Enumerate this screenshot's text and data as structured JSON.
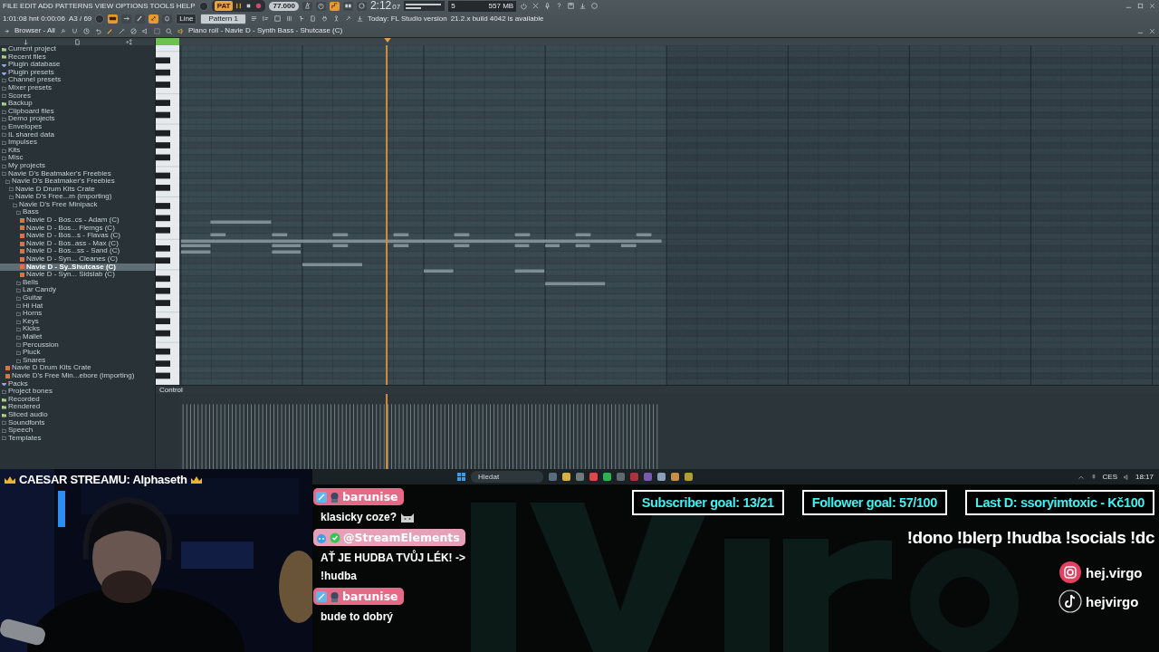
{
  "daw": {
    "menu": "FILE EDIT ADD PATTERNS VIEW OPTIONS TOOLS HELP",
    "pat_label": "PAT",
    "tempo": "77.000",
    "time": "2:12",
    "time_sub": "07",
    "cpu": "5",
    "memory": "557 MB",
    "hint": "1:01:08 hnt 0:00:06",
    "hint_right": "A3 / 69",
    "snap": "Line",
    "pattern": "Pattern 1",
    "news": [
      "Today: FL Studio version",
      "21.2.x build 4042 is available"
    ],
    "toggles_top": [
      {
        "kind": "metronome",
        "on": false
      },
      {
        "kind": "wait",
        "on": false
      },
      {
        "kind": "step",
        "on": true
      },
      {
        "kind": "blend",
        "on": false
      },
      {
        "kind": "loop",
        "on": false
      }
    ],
    "toggles_bottom": [
      {
        "kind": "typing",
        "on": true
      },
      {
        "kind": "arrow",
        "on": false
      },
      {
        "kind": "brush",
        "on": false
      },
      {
        "kind": "link",
        "on": true
      },
      {
        "kind": "bell",
        "on": false
      }
    ],
    "browser_title": "Browser - All",
    "piano_roll_title": "Piano roll - Navie D - Synth Bass - Shutcase (C)",
    "controller": "Control"
  },
  "browser": {
    "items": [
      {
        "label": "Current project",
        "kind": "special",
        "selected": false
      },
      {
        "label": "Recent files",
        "kind": "special",
        "selected": false
      },
      {
        "label": "Plugin database",
        "kind": "plugin",
        "selected": false
      },
      {
        "label": "Plugin presets",
        "kind": "plugin",
        "selected": false
      },
      {
        "label": "Channel presets",
        "kind": "folder",
        "selected": false
      },
      {
        "label": "Mixer presets",
        "kind": "folder",
        "selected": false
      },
      {
        "label": "Scores",
        "kind": "folder",
        "selected": false
      },
      {
        "label": "Backup",
        "kind": "special",
        "selected": false
      },
      {
        "label": "Clipboard files",
        "kind": "folder",
        "selected": false
      },
      {
        "label": "Demo projects",
        "kind": "folder",
        "selected": false
      },
      {
        "label": "Envelopes",
        "kind": "folder",
        "selected": false
      },
      {
        "label": "IL shared data",
        "kind": "folder",
        "selected": false
      },
      {
        "label": "Impulses",
        "kind": "folder",
        "selected": false
      },
      {
        "label": "Kits",
        "kind": "folder",
        "selected": false
      },
      {
        "label": "Misc",
        "kind": "folder",
        "selected": false
      },
      {
        "label": "My projects",
        "kind": "folder",
        "selected": false
      },
      {
        "label": "Navie D's Beatmaker's Freebies",
        "kind": "folder",
        "selected": false,
        "children": [
          {
            "label": "Navie D's Beatmaker's Freebies",
            "kind": "folder",
            "selected": false,
            "children": [
              {
                "label": "Navie D Drum Kits Crate",
                "kind": "folder",
                "selected": false
              },
              {
                "label": "Navie D's Free...m (importing)",
                "kind": "folder",
                "selected": false,
                "children": [
                  {
                    "label": "Navie D's Free Minipack",
                    "kind": "folder",
                    "selected": false,
                    "children": [
                      {
                        "label": "Bass",
                        "kind": "folder",
                        "selected": false,
                        "children": [
                          {
                            "label": "Navie D - Bos..cs - Adam (C)",
                            "kind": "file",
                            "selected": false
                          },
                          {
                            "label": "Navie D - Bos... Flemgs (C)",
                            "kind": "file",
                            "selected": false
                          },
                          {
                            "label": "Navie D - Bos...s - Flavas (C)",
                            "kind": "file",
                            "selected": false
                          },
                          {
                            "label": "Navie D - Bos..ass - Max (C)",
                            "kind": "file",
                            "selected": false
                          },
                          {
                            "label": "Navie D - Bos...ss - Sand (C)",
                            "kind": "file",
                            "selected": false
                          },
                          {
                            "label": "Navie D - Syn... Cleanes (C)",
                            "kind": "file",
                            "selected": false
                          },
                          {
                            "label": "Navie D - Sy..Shutcase (C)",
                            "kind": "file",
                            "selected": true
                          },
                          {
                            "label": "Navie D - Syn... Sidslab (C)",
                            "kind": "file",
                            "selected": false
                          }
                        ]
                      },
                      {
                        "label": "Bells",
                        "kind": "folder",
                        "selected": false
                      },
                      {
                        "label": "Lar Candy",
                        "kind": "folder",
                        "selected": false
                      },
                      {
                        "label": "Guitar",
                        "kind": "folder",
                        "selected": false
                      },
                      {
                        "label": "Hi Hat",
                        "kind": "folder",
                        "selected": false
                      },
                      {
                        "label": "Horns",
                        "kind": "folder",
                        "selected": false
                      },
                      {
                        "label": "Keys",
                        "kind": "folder",
                        "selected": false
                      },
                      {
                        "label": "Kicks",
                        "kind": "folder",
                        "selected": false
                      },
                      {
                        "label": "Mallet",
                        "kind": "folder",
                        "selected": false
                      },
                      {
                        "label": "Percussion",
                        "kind": "folder",
                        "selected": false
                      },
                      {
                        "label": "Pluck",
                        "kind": "folder",
                        "selected": false
                      },
                      {
                        "label": "Snares",
                        "kind": "folder",
                        "selected": false
                      }
                    ]
                  }
                ]
              }
            ]
          },
          {
            "label": "Navie D Drum Kits Crate",
            "kind": "file",
            "selected": false
          },
          {
            "label": "Navie D's Free Min...ebore (importing)",
            "kind": "file",
            "selected": false
          }
        ]
      },
      {
        "label": "Packs",
        "kind": "plugin",
        "selected": false
      },
      {
        "label": "Project bones",
        "kind": "folder",
        "selected": false
      },
      {
        "label": "Recorded",
        "kind": "special",
        "selected": false
      },
      {
        "label": "Rendered",
        "kind": "special",
        "selected": false
      },
      {
        "label": "Sliced audio",
        "kind": "special",
        "selected": false
      },
      {
        "label": "Soundfonts",
        "kind": "folder",
        "selected": false
      },
      {
        "label": "Speech",
        "kind": "folder",
        "selected": false
      },
      {
        "label": "Templates",
        "kind": "folder",
        "selected": false
      }
    ]
  },
  "taskbar": {
    "search_placeholder": "Hledat",
    "language": "CES",
    "clock": "18:17"
  },
  "stream": {
    "top_supporter": "CAESAR STREAMU: Alphaseth",
    "chat": [
      {
        "user": "barunise",
        "kind": "viewer",
        "text": "klasicky coze?",
        "emote": true
      },
      {
        "user": "@StreamElements",
        "kind": "bot",
        "text": "AŤ JE HUDBA TVŮJ LÉK! -> !hudba",
        "emote": false
      },
      {
        "user": "barunise",
        "kind": "viewer",
        "text": "bude to dobrý",
        "emote": false
      }
    ],
    "goals": [
      "Subscriber goal: 13/21",
      "Follower goal: 57/100",
      "Last D: ssoryimtoxic - Kč100"
    ],
    "commands": "!dono !blerp !hudba !socials !dc",
    "socials": [
      {
        "kind": "instagram",
        "handle": "hej.virgo"
      },
      {
        "kind": "tiktok",
        "handle": "hejvirgo"
      }
    ]
  }
}
